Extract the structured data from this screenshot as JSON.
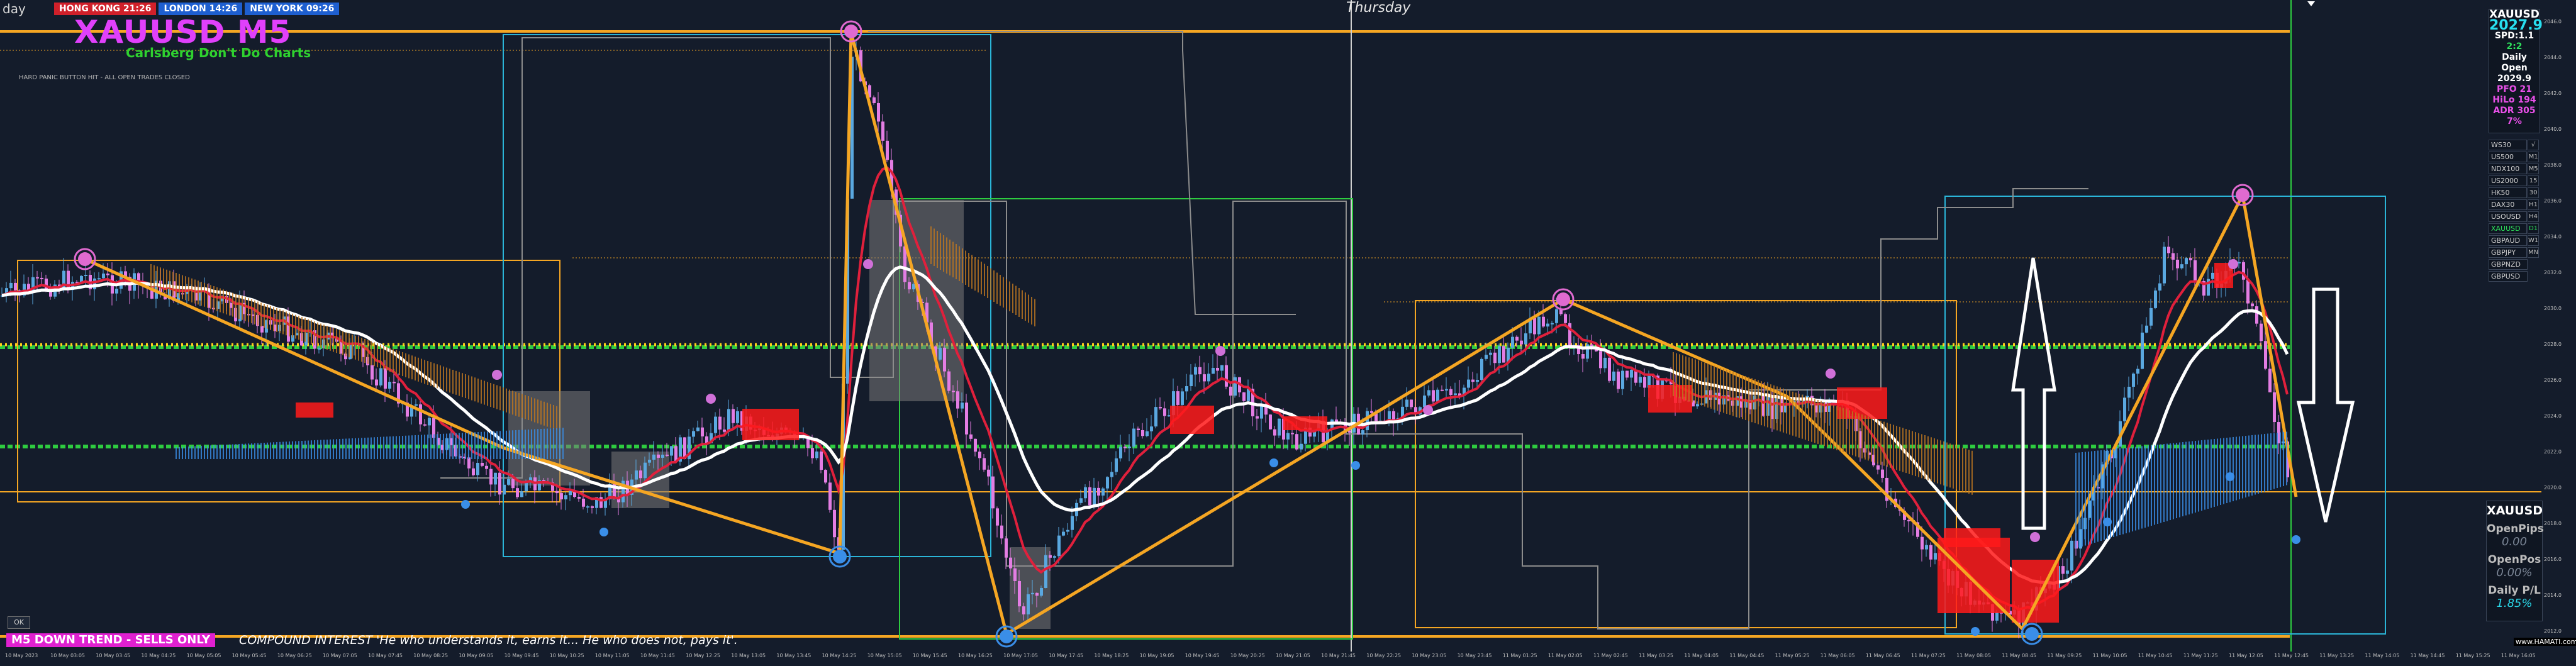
{
  "header": {
    "period_label": "day",
    "symbol_title": "XAUUSD M5",
    "subtitle": "Carlsberg Don't Do Charts",
    "panic_note": "HARD PANIC BUTTON HIT - ALL OPEN TRADES CLOSED",
    "day_label": "Thursday",
    "clocks": [
      {
        "label": "HONG KONG 21:26",
        "color": "#d0202a"
      },
      {
        "label": "LONDON 14:26",
        "color": "#1e5fd0"
      },
      {
        "label": "NEW YORK 09:26",
        "color": "#1e5fd0"
      }
    ]
  },
  "info_panel": {
    "rows": [
      {
        "text": "XAUUSD",
        "color": "#ffffff"
      },
      {
        "text": "2027.9",
        "color": "#28e0f0"
      },
      {
        "text": "SPD:1.1",
        "color": "#ffffff"
      },
      {
        "text": "2:2",
        "color": "#2ee05c"
      },
      {
        "text": "Daily Open",
        "color": "#ffffff"
      },
      {
        "text": "2029.9",
        "color": "#ffffff"
      },
      {
        "text": "PFO 21",
        "color": "#e850e8"
      },
      {
        "text": "HiLo 194",
        "color": "#e850e8"
      },
      {
        "text": "ADR 305",
        "color": "#e850e8"
      },
      {
        "text": "7%",
        "color": "#e850e8"
      }
    ]
  },
  "symbol_list": [
    {
      "name": "WS30",
      "tf": "√",
      "active": false
    },
    {
      "name": "US500",
      "tf": "M1",
      "active": false
    },
    {
      "name": "NDX100",
      "tf": "M5",
      "active": false
    },
    {
      "name": "US2000",
      "tf": "15",
      "active": false
    },
    {
      "name": "HK50",
      "tf": "30",
      "active": false
    },
    {
      "name": "DAX30",
      "tf": "H1",
      "active": false
    },
    {
      "name": "USOUSD",
      "tf": "H4",
      "active": false
    },
    {
      "name": "XAUUSD",
      "tf": "D1",
      "active": true
    },
    {
      "name": "GBPAUD",
      "tf": "W1",
      "active": false
    },
    {
      "name": "GBPJPY",
      "tf": "MN",
      "active": false
    },
    {
      "name": "GBPNZD",
      "tf": "",
      "active": false
    },
    {
      "name": "GBPUSD",
      "tf": "",
      "active": false
    }
  ],
  "pl_panel": {
    "symbol": "XAUUSD",
    "open_pips_label": "OpenPips",
    "open_pips_value": "0.00",
    "open_pos_label": "OpenPos",
    "open_pos_value": "0.00%",
    "daily_pl_label": "Daily P/L",
    "daily_pl_value": "1.85%"
  },
  "bottom": {
    "ok_label": "OK",
    "trend_banner": "M5 DOWN TREND - SELLS ONLY",
    "quote": "COMPOUND INTEREST 'He who understands it, earns it... He who does not, pays it'.",
    "watermark": "www.HAMATI.com"
  },
  "price_axis": [
    "2046.0",
    "2044.0",
    "2042.0",
    "2040.0",
    "2038.0",
    "2036.0",
    "2034.0",
    "2032.0",
    "2030.0",
    "2028.0",
    "2026.0",
    "2024.0",
    "2022.0",
    "2020.0",
    "2018.0",
    "2016.0",
    "2014.0",
    "2012.0"
  ],
  "time_axis": [
    "10 May 2023",
    "10 May 03:05",
    "10 May 03:45",
    "10 May 04:25",
    "10 May 05:05",
    "10 May 05:45",
    "10 May 06:25",
    "10 May 07:05",
    "10 May 07:45",
    "10 May 08:25",
    "10 May 09:05",
    "10 May 09:45",
    "10 May 10:25",
    "10 May 11:05",
    "10 May 11:45",
    "10 May 12:25",
    "10 May 13:05",
    "10 May 13:45",
    "10 May 14:25",
    "10 May 15:05",
    "10 May 15:45",
    "10 May 16:25",
    "10 May 17:05",
    "10 May 17:45",
    "10 May 18:25",
    "10 May 19:05",
    "10 May 19:45",
    "10 May 20:25",
    "10 May 21:05",
    "10 May 21:45",
    "10 May 22:25",
    "10 May 23:05",
    "10 May 23:45",
    "11 May 01:25",
    "11 May 02:05",
    "11 May 02:45",
    "11 May 03:25",
    "11 May 04:05",
    "11 May 04:45",
    "11 May 05:25",
    "11 May 06:05",
    "11 May 06:45",
    "11 May 07:25",
    "11 May 08:05",
    "11 May 08:45",
    "11 May 09:25",
    "11 May 10:05",
    "11 May 10:45",
    "11 May 11:25",
    "11 May 12:05",
    "11 May 12:45",
    "11 May 13:25",
    "11 May 14:05",
    "11 May 14:45",
    "11 May 15:25",
    "11 May 16:05"
  ]
}
